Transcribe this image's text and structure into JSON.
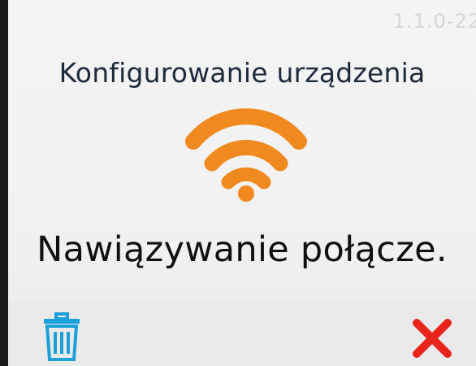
{
  "header": {
    "version": "1.1.0-22"
  },
  "title": "Konfigurowanie urządzenia",
  "status_text": "Nawiązywanie połącze.",
  "icons": {
    "wifi": "wifi-icon",
    "trash": "trash-icon",
    "close": "close-icon"
  },
  "colors": {
    "accent": "#f0891e",
    "trash": "#1ca0d8",
    "close": "#e8241d",
    "title": "#1e2a3c",
    "status": "#101010"
  }
}
